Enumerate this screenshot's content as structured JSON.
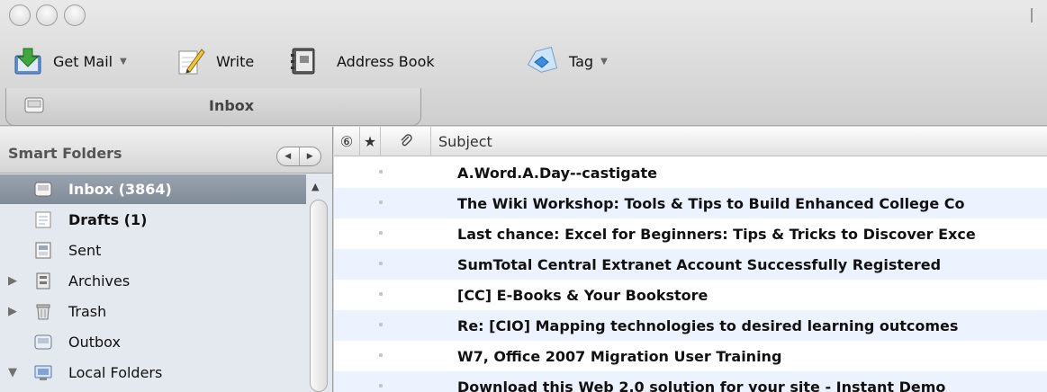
{
  "toolbar": {
    "get_mail_label": "Get Mail",
    "write_label": "Write",
    "address_book_label": "Address Book",
    "tag_label": "Tag",
    "dropdown_glyph": "▼"
  },
  "tabs": [
    {
      "label": "Inbox",
      "icon": "inbox-tray-icon"
    }
  ],
  "sidebar": {
    "title": "Smart Folders",
    "view_switch": [
      "◀",
      "▶"
    ],
    "folders": [
      {
        "label": "Inbox (3864)",
        "icon": "inbox-tray-icon",
        "selected": true
      },
      {
        "label": "Drafts (1)",
        "icon": "drafts-icon",
        "bold": true
      },
      {
        "label": "Sent",
        "icon": "sent-icon"
      },
      {
        "label": "Archives",
        "icon": "archives-icon",
        "twisty": "▶"
      },
      {
        "label": "Trash",
        "icon": "trash-icon",
        "twisty": "▶"
      },
      {
        "label": "Outbox",
        "icon": "outbox-icon"
      },
      {
        "label": "Local Folders",
        "icon": "local-folders-icon",
        "twisty": "▼"
      }
    ]
  },
  "message_list": {
    "columns": {
      "thread_glyph": "⑥",
      "star_glyph": "★",
      "attach_glyph": "✎",
      "subject": "Subject"
    },
    "messages": [
      "A.Word.A.Day--castigate",
      "The Wiki Workshop: Tools & Tips to Build Enhanced College Co",
      "Last chance: Excel for Beginners: Tips & Tricks to Discover Exce",
      "SumTotal Central Extranet Account Successfully Registered",
      "[CC] E-Books & Your Bookstore",
      "Re: [CIO] Mapping technologies to desired learning outcomes",
      "W7, Office 2007 Migration User Training",
      "Download this Web 2.0 solution for your site - Instant Demo"
    ]
  },
  "colors": {
    "selection": "#8a95a2",
    "alt_row": "#edf3fe",
    "sidebar_bg": "#e4e9ef"
  }
}
